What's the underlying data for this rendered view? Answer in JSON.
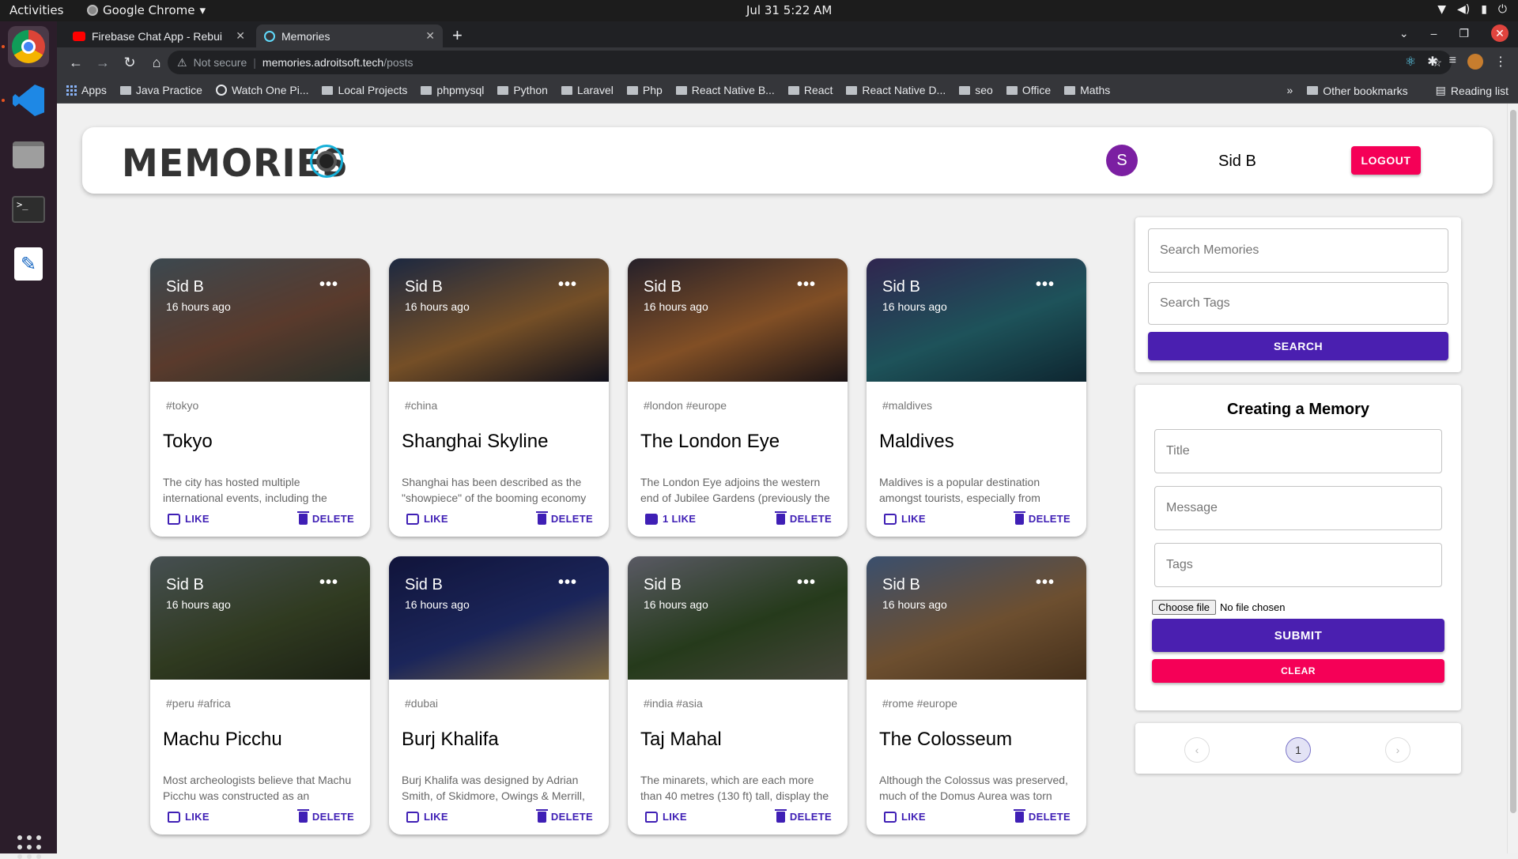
{
  "os": {
    "activities": "Activities",
    "app_name": "Google Chrome",
    "clock": "Jul 31  5:22 AM"
  },
  "browser": {
    "tabs": [
      {
        "title": "Firebase Chat App - Rebui"
      },
      {
        "title": "Memories"
      }
    ],
    "address": {
      "security": "Not secure",
      "host": "memories.adroitsoft.tech",
      "path": "/posts"
    },
    "bookmarks": [
      "Apps",
      "Java Practice",
      "Watch One Pi...",
      "Local Projects",
      "phpmysql",
      "Python",
      "Laravel",
      "Php",
      "React Native B...",
      "React",
      "React Native D...",
      "seo",
      "Office",
      "Maths"
    ],
    "bookmarks_overflow": "»",
    "other_bookmarks": "Other bookmarks",
    "reading_list": "Reading list"
  },
  "header": {
    "logo_text": "MEMORIES",
    "avatar_letter": "S",
    "user_name": "Sid B",
    "logout_label": "LOGOUT"
  },
  "posts": [
    {
      "author": "Sid B",
      "time": "16 hours ago",
      "tags": "#tokyo",
      "title": "Tokyo",
      "message": "The city has hosted multiple international events, including the",
      "like": "LIKE",
      "delete": "DELETE",
      "colors": [
        "#5d6f7a",
        "#8a5a44",
        "#3f4a40"
      ]
    },
    {
      "author": "Sid B",
      "time": "16 hours ago",
      "tags": "#china",
      "title": "Shanghai Skyline",
      "message": "Shanghai has been described as the \"showpiece\" of the booming economy",
      "like": "LIKE",
      "delete": "DELETE",
      "colors": [
        "#2c3e63",
        "#b47a3c",
        "#1a1a2a"
      ]
    },
    {
      "author": "Sid B",
      "time": "16 hours ago",
      "tags": "#london #europe",
      "title": "The London Eye",
      "message": "The London Eye adjoins the western end of Jubilee Gardens (previously the",
      "like": "1 LIKE",
      "delete": "DELETE",
      "colors": [
        "#3a3240",
        "#c77a3a",
        "#2a1f22"
      ]
    },
    {
      "author": "Sid B",
      "time": "16 hours ago",
      "tags": "#maldives",
      "title": "Maldives",
      "message": "Maldives is a popular destination amongst tourists, especially from",
      "like": "LIKE",
      "delete": "DELETE",
      "colors": [
        "#4a3a7a",
        "#2e7f8a",
        "#163a4a"
      ]
    },
    {
      "author": "Sid B",
      "time": "16 hours ago",
      "tags": "#peru #africa",
      "title": "Machu Picchu",
      "message": "Most archeologists believe that Machu Picchu was constructed as an",
      "like": "LIKE",
      "delete": "DELETE",
      "colors": [
        "#6c7a7e",
        "#4a5a32",
        "#2c3420"
      ]
    },
    {
      "author": "Sid B",
      "time": "16 hours ago",
      "tags": "#dubai",
      "title": "Burj Khalifa",
      "message": "Burj Khalifa was designed by Adrian Smith, of Skidmore, Owings & Merrill,",
      "like": "LIKE",
      "delete": "DELETE",
      "colors": [
        "#1a1f5a",
        "#2a3a8a",
        "#c0a060"
      ]
    },
    {
      "author": "Sid B",
      "time": "16 hours ago",
      "tags": "#india #asia",
      "title": "Taj Mahal",
      "message": "The minarets, which are each more than 40 metres (130 ft) tall, display the",
      "like": "LIKE",
      "delete": "DELETE",
      "colors": [
        "#8a8a9a",
        "#3a5a2a",
        "#6a6a5a"
      ]
    },
    {
      "author": "Sid B",
      "time": "16 hours ago",
      "tags": "#rome #europe",
      "title": "The Colosseum",
      "message": "Although the Colossus was preserved, much of the Domus Aurea was torn",
      "like": "LIKE",
      "delete": "DELETE",
      "colors": [
        "#5a7aa8",
        "#a87a4a",
        "#6a4a2a"
      ]
    }
  ],
  "search": {
    "memories_placeholder": "Search Memories",
    "tags_placeholder": "Search Tags",
    "button_label": "SEARCH"
  },
  "form": {
    "heading": "Creating a Memory",
    "title_placeholder": "Title",
    "message_placeholder": "Message",
    "tags_placeholder": "Tags",
    "file_button": "Choose file",
    "file_status": "No file chosen",
    "submit_label": "SUBMIT",
    "clear_label": "CLEAR"
  },
  "pagination": {
    "prev": "‹",
    "current": "1",
    "next": "›"
  },
  "colors": {
    "primary": "#4a1fb0",
    "secondary": "#f50057",
    "avatar": "#7b1fa2"
  }
}
